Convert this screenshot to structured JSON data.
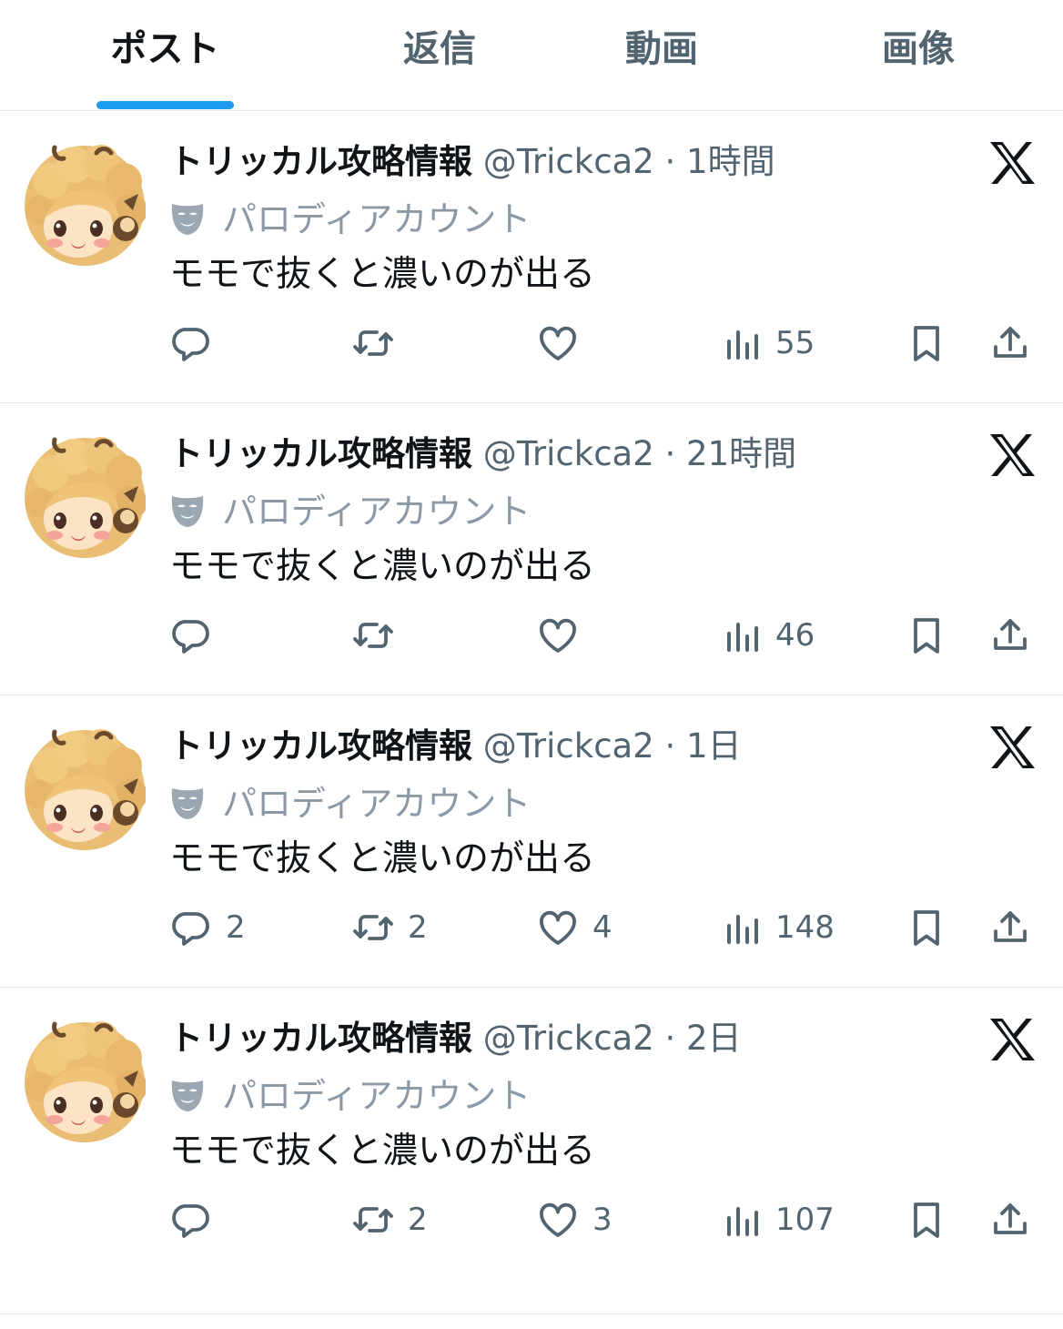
{
  "tabs": [
    {
      "label": "ポスト",
      "active": true
    },
    {
      "label": "返信",
      "active": false
    },
    {
      "label": "動画",
      "active": false
    },
    {
      "label": "画像",
      "active": false
    }
  ],
  "posts": [
    {
      "name": "トリッカル攻略情報",
      "handle": "@Trickca2",
      "time": "1時間",
      "parody": "パロディアカウント",
      "text": "モモで抜くと濃いのが出る",
      "replies": "",
      "reposts": "",
      "likes": "",
      "views": "55"
    },
    {
      "name": "トリッカル攻略情報",
      "handle": "@Trickca2",
      "time": "21時間",
      "parody": "パロディアカウント",
      "text": "モモで抜くと濃いのが出る",
      "replies": "",
      "reposts": "",
      "likes": "",
      "views": "46"
    },
    {
      "name": "トリッカル攻略情報",
      "handle": "@Trickca2",
      "time": "1日",
      "parody": "パロディアカウント",
      "text": "モモで抜くと濃いのが出る",
      "replies": "2",
      "reposts": "2",
      "likes": "4",
      "views": "148"
    },
    {
      "name": "トリッカル攻略情報",
      "handle": "@Trickca2",
      "time": "2日",
      "parody": "パロディアカウント",
      "text": "モモで抜くと濃いのが出る",
      "replies": "",
      "reposts": "2",
      "likes": "3",
      "views": "107"
    }
  ],
  "separator": "·",
  "icons": {
    "reply": "reply-icon",
    "repost": "repost-icon",
    "like": "heart-icon",
    "views": "views-chart-icon",
    "bookmark": "bookmark-icon",
    "share": "share-icon",
    "x_logo": "x-logo-icon",
    "parody": "parody-mask-icon"
  },
  "colors": {
    "accent": "#1d9bf0",
    "text": "#0f1419",
    "secondary": "#536471",
    "divider": "#e1e5e8"
  }
}
